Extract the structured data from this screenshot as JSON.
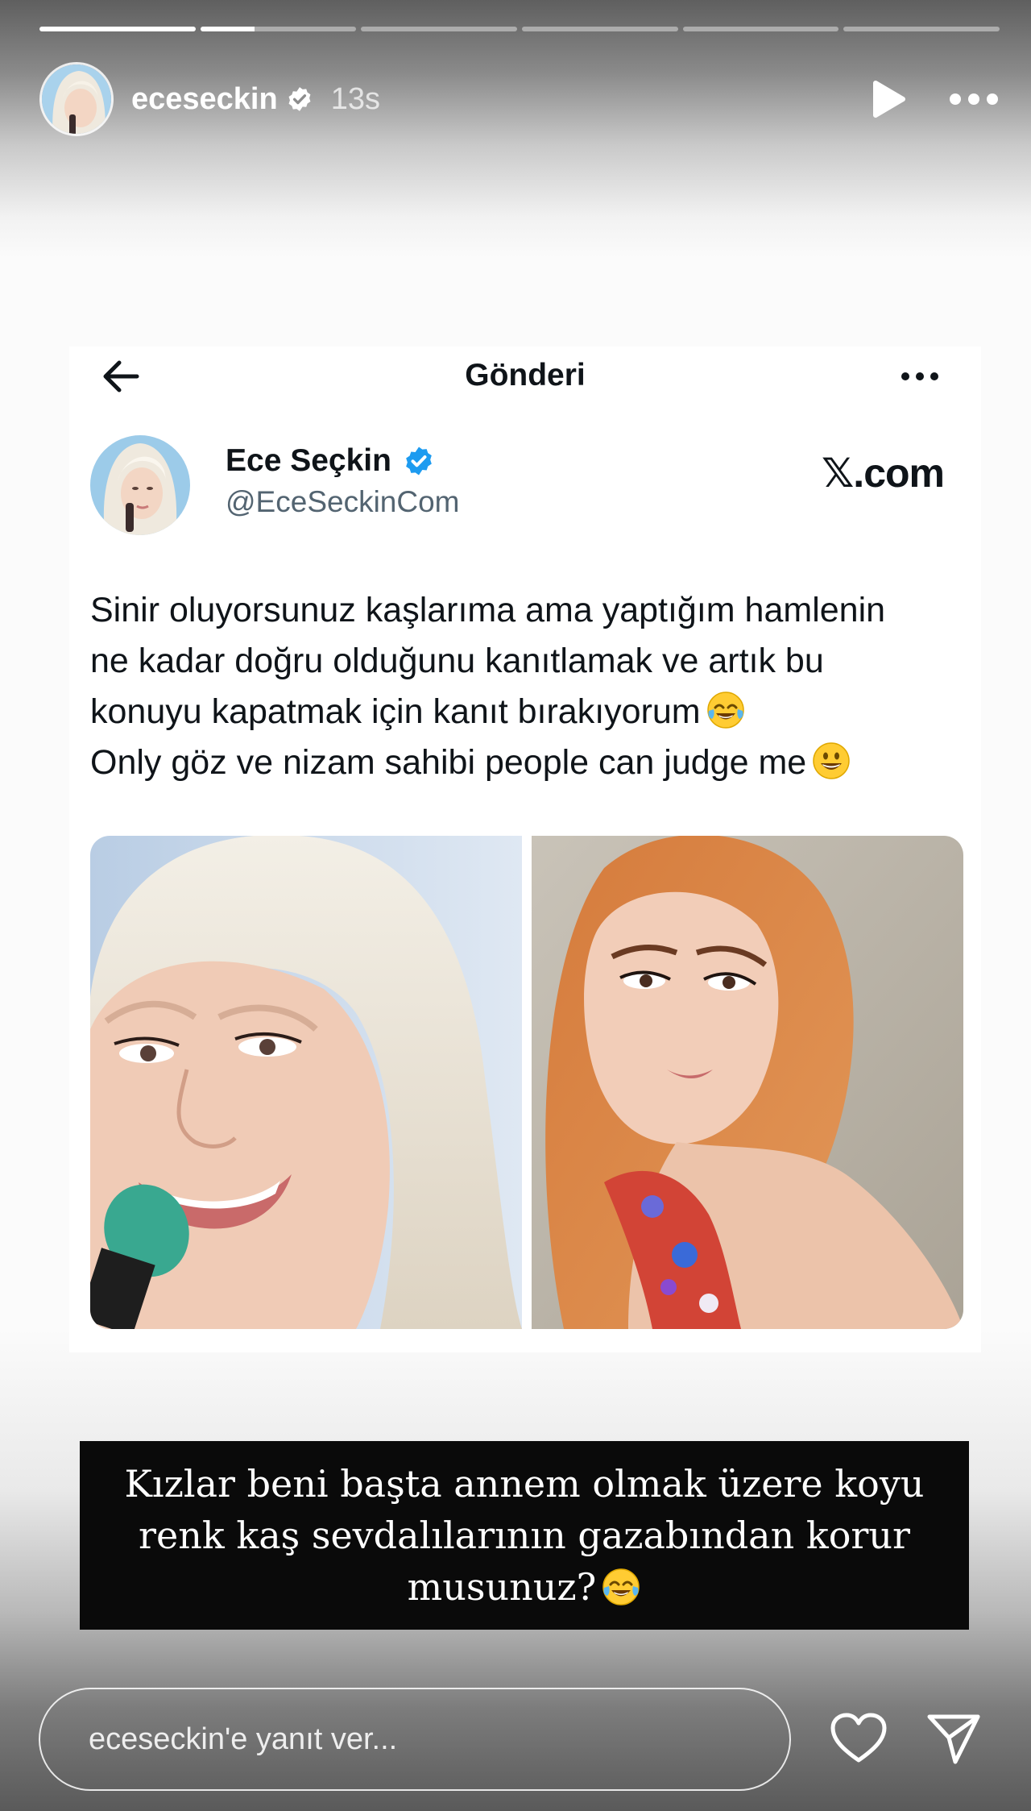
{
  "story": {
    "progress": {
      "segments": 6,
      "active_index": 1,
      "active_fraction": 0.35
    },
    "username": "eceseckin",
    "time": "13s",
    "icons": {
      "verified": "verified-badge-icon",
      "play": "play-icon",
      "more": "more-horizontal-icon"
    }
  },
  "tweet": {
    "top_title": "Gönderi",
    "author_name": "Ece Seçkin",
    "author_handle": "@EceSeckinCom",
    "site_logo": "𝕏.com",
    "text_lines": [
      "Sinir oluyorsunuz kaşlarıma ama yaptığım hamlenin",
      "ne kadar doğru olduğunu kanıtlamak ve artık bu",
      "konuyu kapatmak için kanıt bırakıyorum",
      "Only göz ve nizam sahibi people can judge me"
    ],
    "media_count": 2
  },
  "caption": {
    "lines": [
      "Kızlar beni başta annem olmak üzere koyu",
      "renk kaş sevdalılarının gazabından korur",
      "musunuz?"
    ]
  },
  "reply": {
    "placeholder": "eceseckin'e yanıt ver..."
  },
  "colors": {
    "verified_blue": "#1d9bf0",
    "caption_bg": "#0a0a0a",
    "handle_gray": "#536471"
  }
}
